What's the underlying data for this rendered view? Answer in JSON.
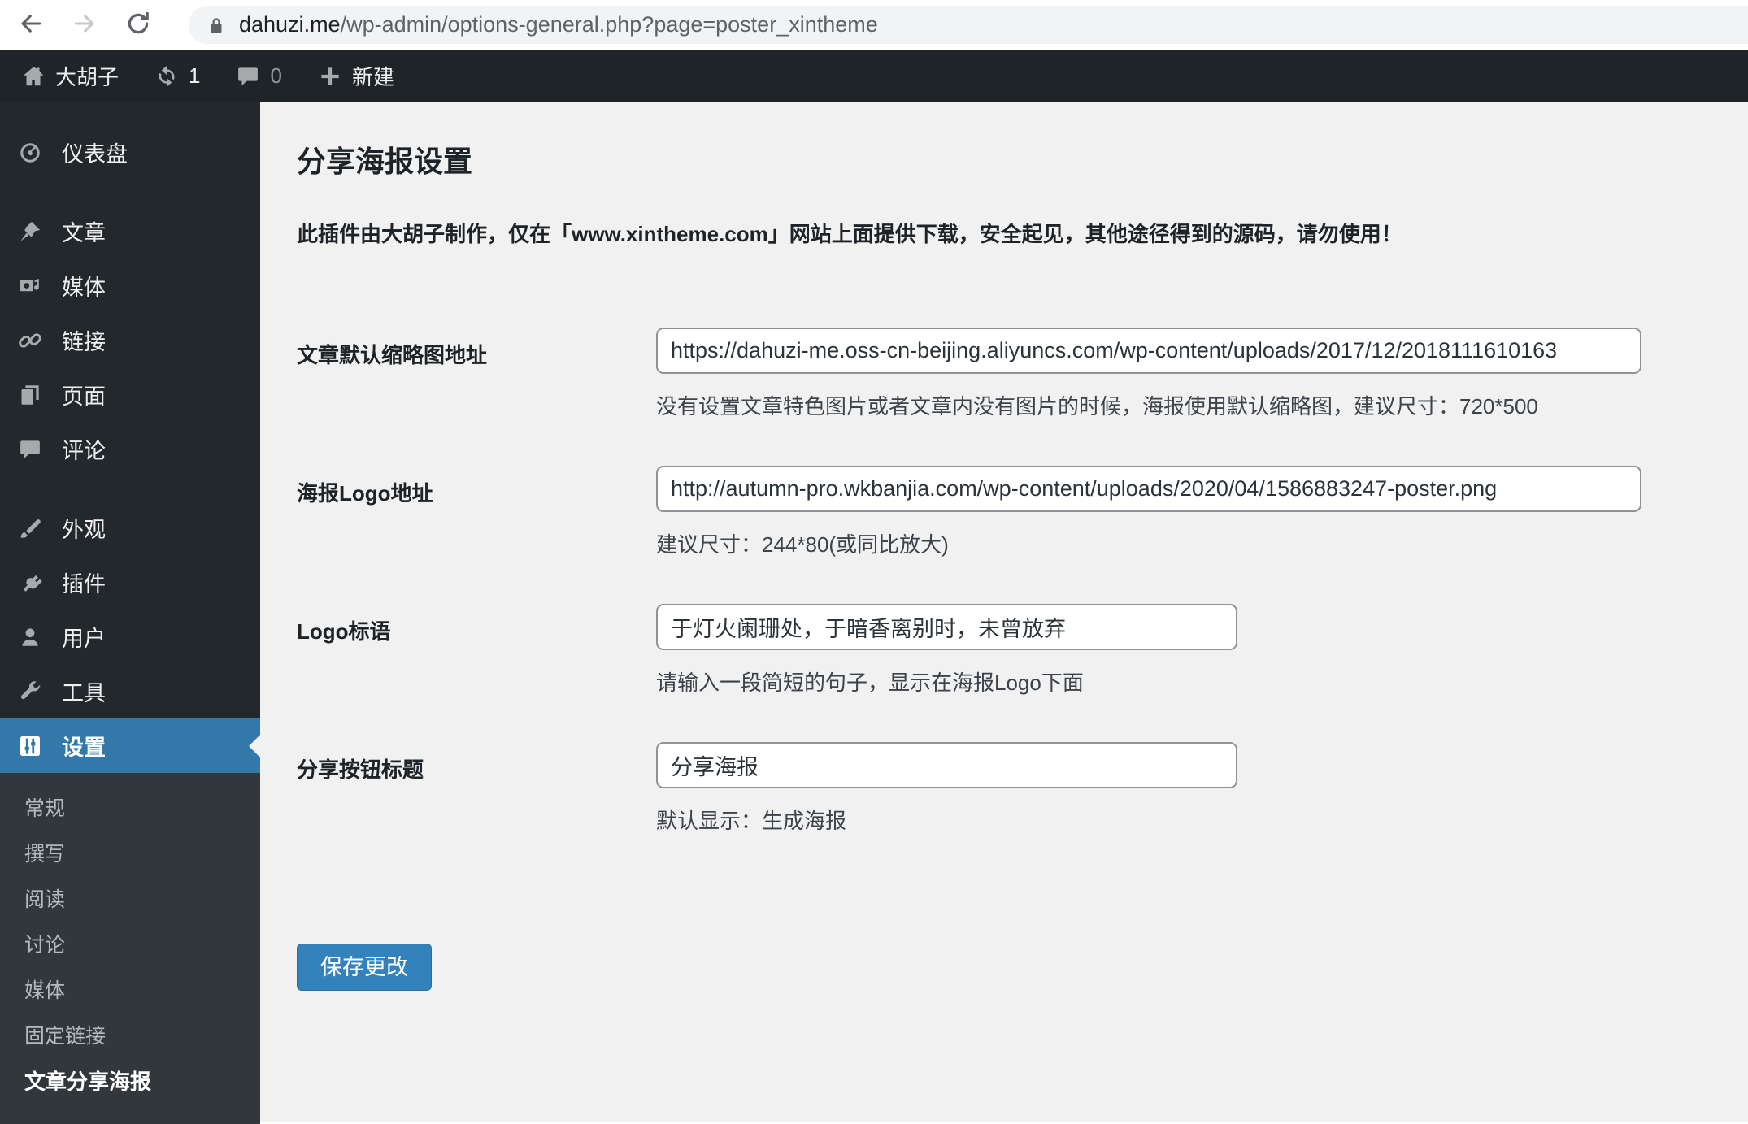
{
  "browser": {
    "url_host": "dahuzi.me",
    "url_path": "/wp-admin/options-general.php?page=poster_xintheme"
  },
  "admin_bar": {
    "site_name": "大胡子",
    "update_count": "1",
    "comment_count": "0",
    "new_label": "新建"
  },
  "sidebar": {
    "items": [
      {
        "name": "dashboard",
        "icon": "dashboard-icon",
        "label": "仪表盘"
      },
      {
        "name": "posts",
        "icon": "pin-icon",
        "label": "文章",
        "group_start": true
      },
      {
        "name": "media",
        "icon": "media-icon",
        "label": "媒体"
      },
      {
        "name": "links",
        "icon": "link-icon",
        "label": "链接"
      },
      {
        "name": "pages",
        "icon": "pages-icon",
        "label": "页面"
      },
      {
        "name": "comments",
        "icon": "comment-icon",
        "label": "评论"
      },
      {
        "name": "appearance",
        "icon": "brush-icon",
        "label": "外观",
        "group_start": true
      },
      {
        "name": "plugins",
        "icon": "plug-icon",
        "label": "插件"
      },
      {
        "name": "users",
        "icon": "user-icon",
        "label": "用户"
      },
      {
        "name": "tools",
        "icon": "wrench-icon",
        "label": "工具"
      },
      {
        "name": "settings",
        "icon": "sliders-icon",
        "label": "设置",
        "active": true,
        "submenu": [
          {
            "name": "general",
            "label": "常规"
          },
          {
            "name": "writing",
            "label": "撰写"
          },
          {
            "name": "reading",
            "label": "阅读"
          },
          {
            "name": "discussion",
            "label": "讨论"
          },
          {
            "name": "media-settings",
            "label": "媒体"
          },
          {
            "name": "permalinks",
            "label": "固定链接"
          },
          {
            "name": "poster-share",
            "label": "文章分享海报",
            "current": true
          }
        ]
      }
    ]
  },
  "main": {
    "title": "分享海报设置",
    "notice": "此插件由大胡子制作，仅在「www.xintheme.com」网站上面提供下载，安全起见，其他途径得到的源码，请勿使用！",
    "fields": [
      {
        "name": "default-thumbnail-url",
        "label": "文章默认缩略图地址",
        "value": "https://dahuzi-me.oss-cn-beijing.aliyuncs.com/wp-content/uploads/2017/12/2018111610163",
        "hint": "没有设置文章特色图片或者文章内没有图片的时候，海报使用默认缩略图，建议尺寸：720*500",
        "size": "wide"
      },
      {
        "name": "poster-logo-url",
        "label": "海报Logo地址",
        "value": "http://autumn-pro.wkbanjia.com/wp-content/uploads/2020/04/1586883247-poster.png",
        "hint": "建议尺寸：244*80(或同比放大)",
        "size": "wide"
      },
      {
        "name": "logo-slogan",
        "label": "Logo标语",
        "value": "于灯火阑珊处，于暗香离别时，未曾放弃",
        "hint": "请输入一段简短的句子，显示在海报Logo下面",
        "size": "narrow"
      },
      {
        "name": "share-button-title",
        "label": "分享按钮标题",
        "value": "分享海报",
        "hint": "默认显示：生成海报",
        "size": "narrow"
      }
    ],
    "save_label": "保存更改"
  },
  "colors": {
    "accent_menu_active": "#3278a8",
    "accent_button": "#3382bb",
    "sidebar_bg": "#23282d",
    "submenu_bg": "#32373c",
    "content_bg": "#f1f1f1"
  }
}
